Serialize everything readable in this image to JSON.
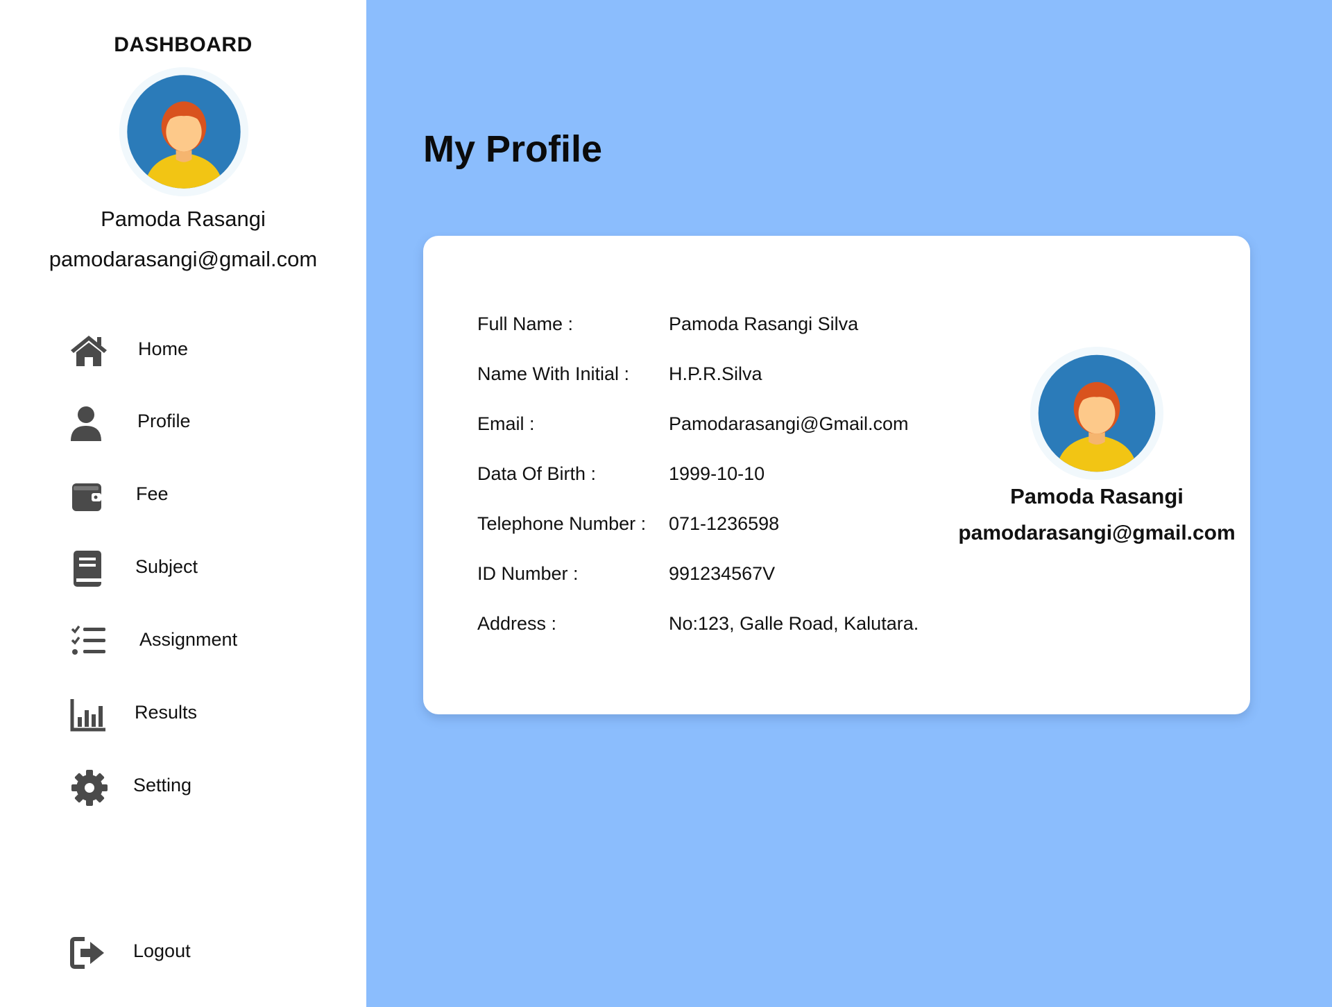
{
  "sidebar": {
    "title": "DASHBOARD",
    "user_name": "Pamoda Rasangi",
    "user_email": "pamodarasangi@gmail.com",
    "nav": [
      {
        "label": "Home",
        "icon": "home-icon"
      },
      {
        "label": "Profile",
        "icon": "user-icon"
      },
      {
        "label": "Fee",
        "icon": "wallet-icon"
      },
      {
        "label": "Subject",
        "icon": "book-icon"
      },
      {
        "label": "Assignment",
        "icon": "checklist-icon"
      },
      {
        "label": "Results",
        "icon": "bar-chart-icon"
      },
      {
        "label": "Setting",
        "icon": "gear-icon"
      }
    ],
    "logout": {
      "label": "Logout",
      "icon": "logout-icon"
    }
  },
  "main": {
    "title": "My Profile",
    "profile": {
      "fields": [
        {
          "label": "Full Name :",
          "value": "Pamoda Rasangi Silva"
        },
        {
          "label": "Name With Initial :",
          "value": "H.P.R.Silva"
        },
        {
          "label": "Email :",
          "value": "Pamodarasangi@Gmail.com"
        },
        {
          "label": "Data Of Birth :",
          "value": "1999-10-10"
        },
        {
          "label": "Telephone Number :",
          "value": "071-1236598"
        },
        {
          "label": "ID Number :",
          "value": "991234567V"
        },
        {
          "label": "Address :",
          "value": "No:123, Galle Road, Kalutara."
        }
      ],
      "name": "Pamoda Rasangi",
      "email": "pamodarasangi@gmail.com"
    }
  },
  "colors": {
    "background": "#8bbdfd",
    "sidebar": "#ffffff",
    "card": "#ffffff",
    "icon": "#4a4a4a",
    "avatar_bg": "#2b7bb9",
    "avatar_shirt": "#f2c514",
    "avatar_hair": "#d9531e",
    "avatar_skin": "#fdc98a"
  }
}
